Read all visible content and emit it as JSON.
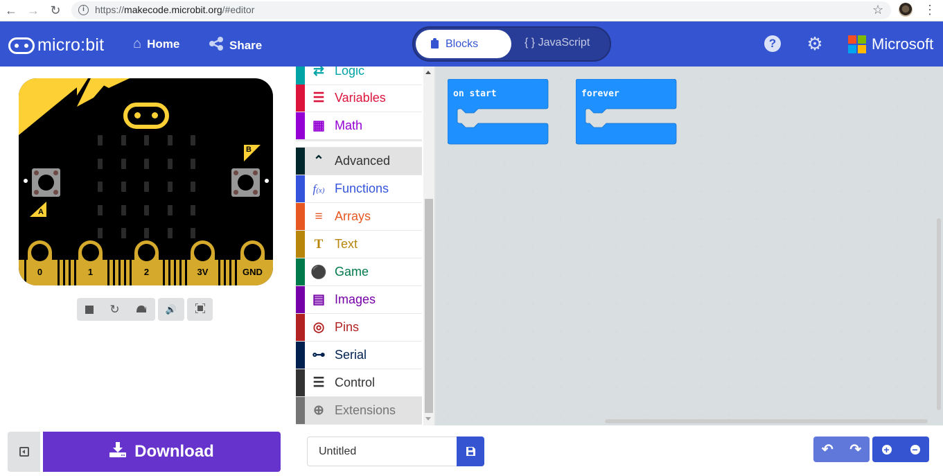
{
  "browser": {
    "back_icon": "arrow-left-icon",
    "forward_icon": "arrow-right-icon",
    "reload_icon": "reload-icon",
    "url_prefix": "https://",
    "url_host": "makecode.microbit.org",
    "url_path": "/#editor",
    "bookmark_icon": "star-icon",
    "menu_icon": "kebab-icon"
  },
  "header": {
    "logo_text": "micro:bit",
    "home_label": "Home",
    "share_label": "Share",
    "editor_toggle": {
      "blocks_label": "Blocks",
      "javascript_label": "{ } JavaScript",
      "selected": "Blocks"
    },
    "help_icon": "help-icon",
    "settings_icon": "gear-icon",
    "brand_text": "Microsoft",
    "brand_colors": [
      "#f25022",
      "#7fba00",
      "#00a4ef",
      "#ffb900"
    ],
    "bg_color": "#3454d1"
  },
  "simulator": {
    "button_a_label": "A",
    "button_b_label": "B",
    "pins": [
      "0",
      "1",
      "2",
      "3V",
      "GND"
    ],
    "led_rows": 5,
    "led_cols": 5,
    "controls": {
      "stop": "stop-icon",
      "restart": "restart-icon",
      "slow_mo": "snail-icon",
      "mute": "volume-icon",
      "fullscreen": "fullscreen-icon"
    }
  },
  "toolbox": {
    "categories": [
      {
        "label": "Logic",
        "color": "#00a4a6",
        "icon": "shuffle-icon"
      },
      {
        "label": "Variables",
        "color": "#dc143c",
        "icon": "list-icon"
      },
      {
        "label": "Math",
        "color": "#9400d3",
        "icon": "calculator-icon"
      },
      {
        "label": "Advanced",
        "color": "#00272b",
        "icon": "chevron-up-icon"
      },
      {
        "label": "Functions",
        "color": "#3455db",
        "icon": "function-icon"
      },
      {
        "label": "Arrays",
        "color": "#e65722",
        "icon": "numbered-list-icon"
      },
      {
        "label": "Text",
        "color": "#b8860b",
        "icon": "text-icon"
      },
      {
        "label": "Game",
        "color": "#007a4b",
        "icon": "gamepad-icon"
      },
      {
        "label": "Images",
        "color": "#7600a8",
        "icon": "image-icon"
      },
      {
        "label": "Pins",
        "color": "#b22222",
        "icon": "target-icon"
      },
      {
        "label": "Serial",
        "color": "#002050",
        "icon": "usb-icon"
      },
      {
        "label": "Control",
        "color": "#333333",
        "icon": "server-icon"
      },
      {
        "label": "Extensions",
        "color": "#757575",
        "icon": "plus-circle-icon"
      }
    ]
  },
  "workspace": {
    "blocks": [
      {
        "label": "on start",
        "color": "#1e90ff"
      },
      {
        "label": "forever",
        "color": "#1e90ff"
      }
    ]
  },
  "footer": {
    "download_label": "Download",
    "project_name_value": "Untitled",
    "save_icon": "save-icon",
    "undo_icon": "undo-icon",
    "redo_icon": "redo-icon",
    "zoom_in_icon": "zoom-in-icon",
    "zoom_out_icon": "zoom-out-icon"
  }
}
